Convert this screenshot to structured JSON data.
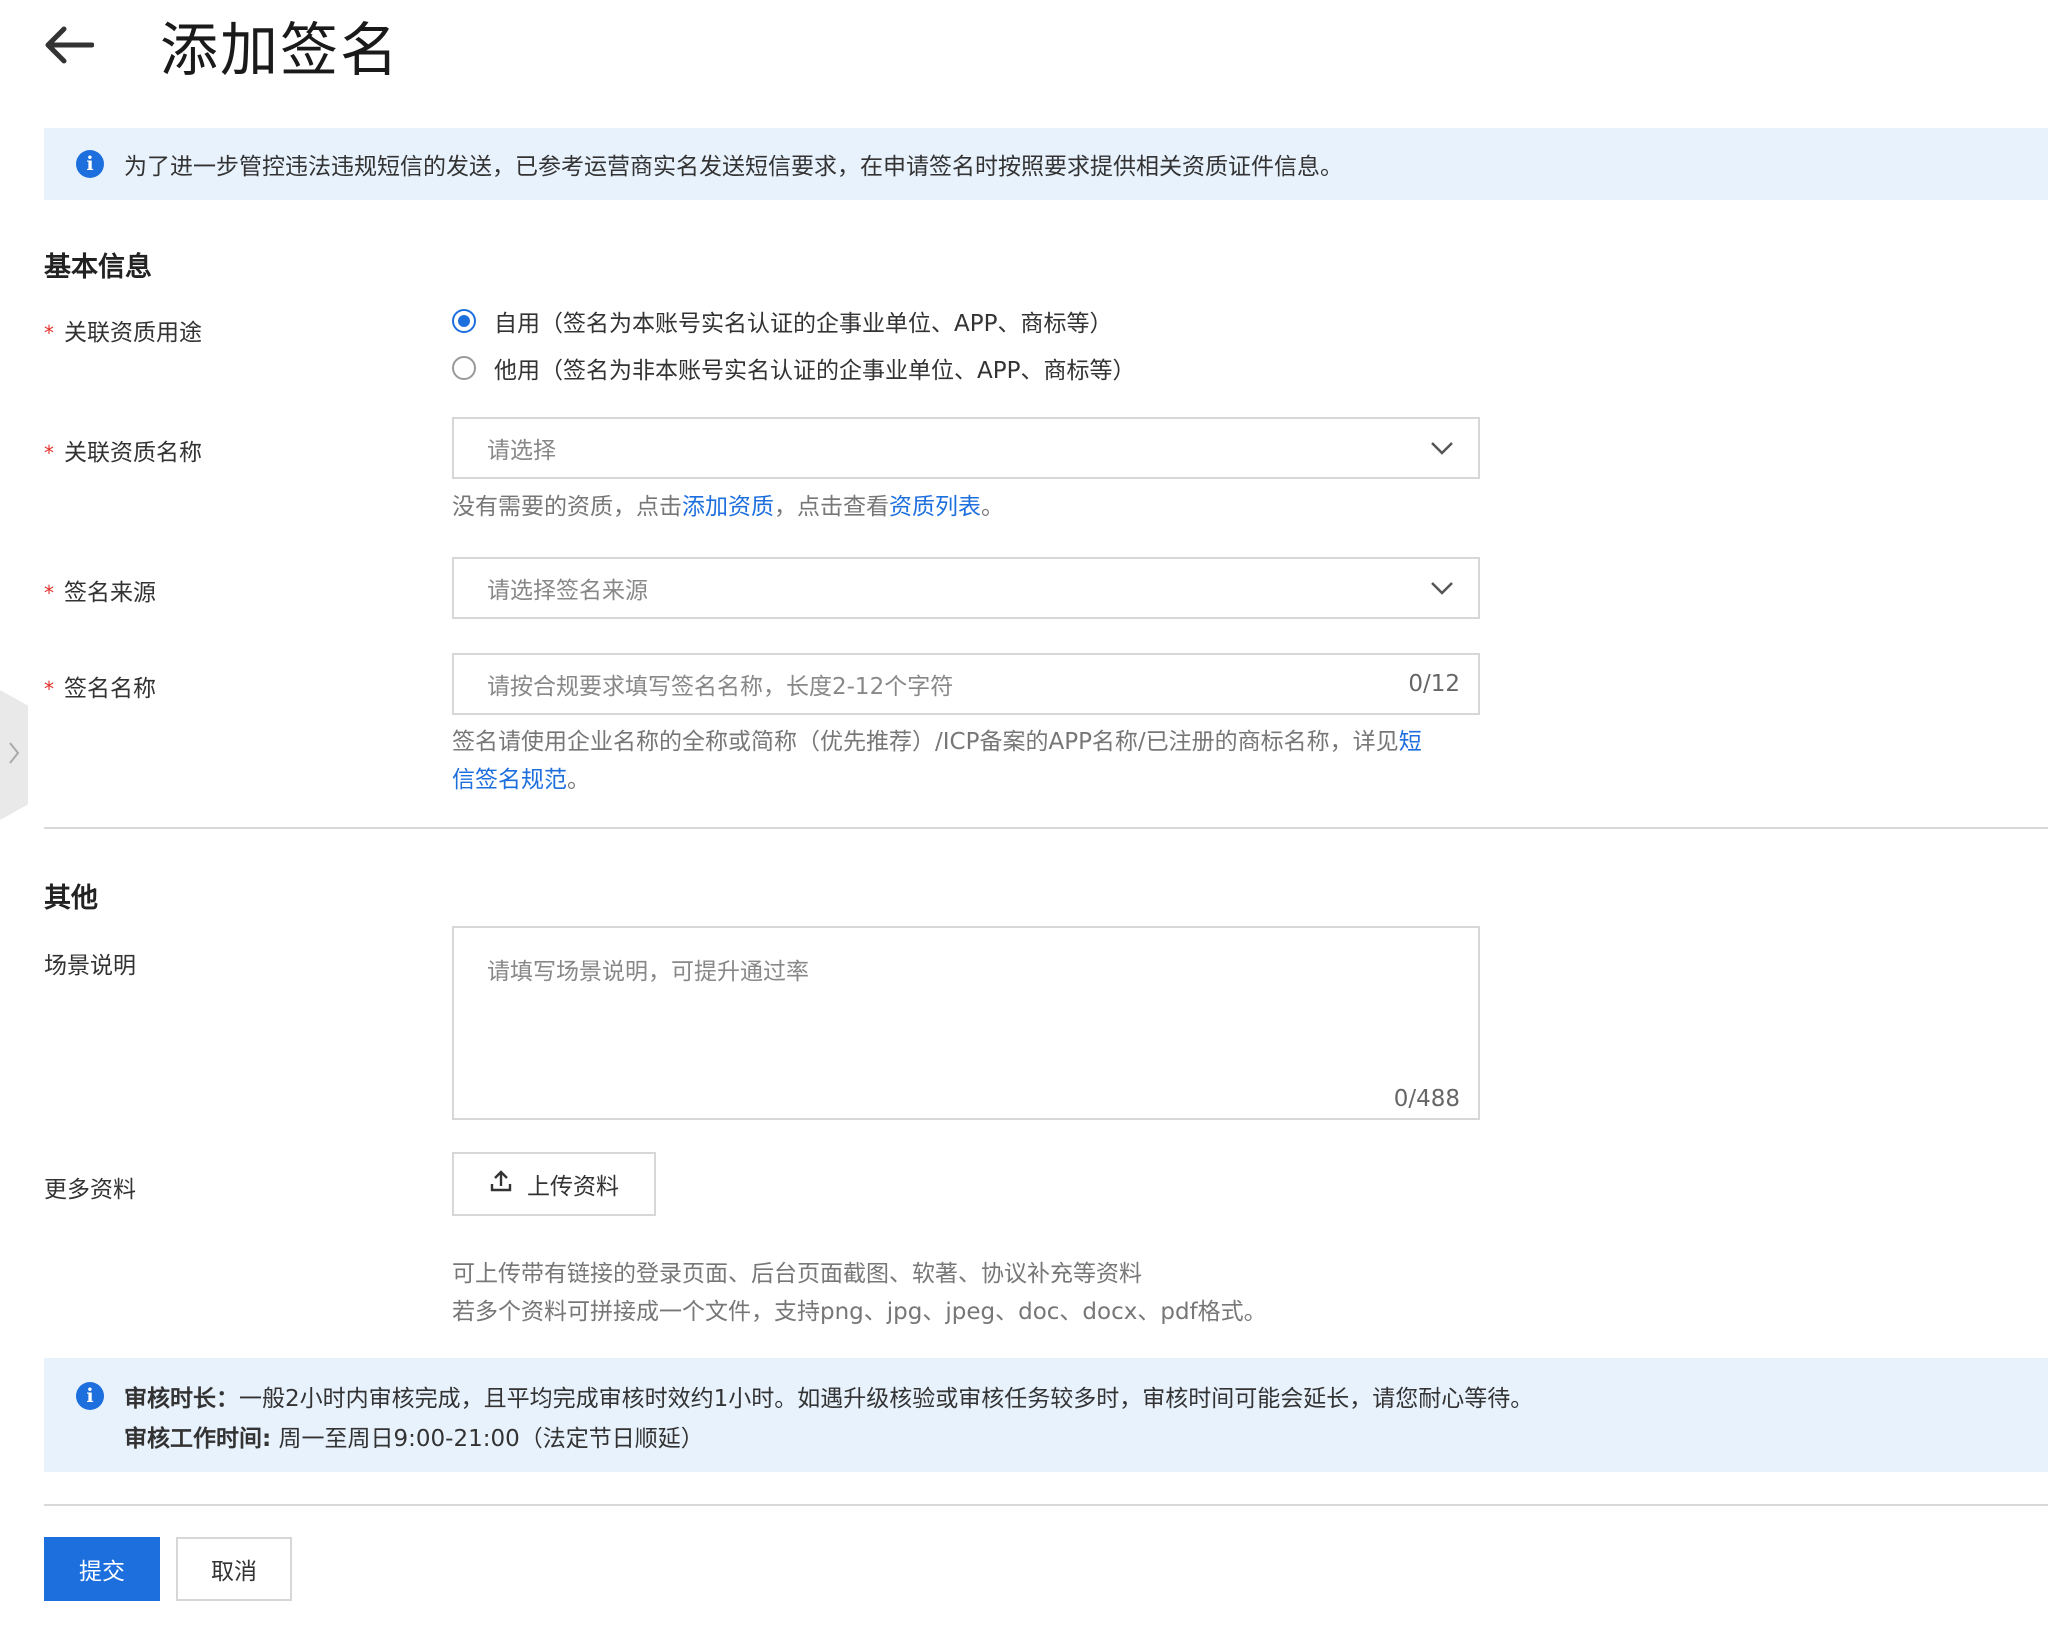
{
  "header": {
    "title": "添加签名"
  },
  "notice_top": {
    "text": "为了进一步管控违法违规短信的发送，已参考运营商实名发送短信要求，在申请签名时按照要求提供相关资质证件信息。"
  },
  "basic_section": {
    "title": "基本信息",
    "usage": {
      "label": "关联资质用途",
      "options": [
        {
          "label": "自用（签名为本账号实名认证的企事业单位、APP、商标等）",
          "checked": true
        },
        {
          "label": "他用（签名为非本账号实名认证的企事业单位、APP、商标等）",
          "checked": false
        }
      ]
    },
    "qualification": {
      "label": "关联资质名称",
      "placeholder": "请选择",
      "help_prefix": "没有需要的资质，点击",
      "help_link1": "添加资质",
      "help_middle": "，点击查看",
      "help_link2": "资质列表",
      "help_suffix": "。"
    },
    "source": {
      "label": "签名来源",
      "placeholder": "请选择签名来源"
    },
    "name": {
      "label": "签名名称",
      "placeholder": "请按合规要求填写签名名称，长度2-12个字符",
      "counter": "0/12",
      "help_prefix": "签名请使用企业名称的全称或简称（优先推荐）/ICP备案的APP名称/已注册的商标名称，详见",
      "help_link_a": "短",
      "help_link_b": "信签名规范",
      "help_suffix": "。"
    }
  },
  "other_section": {
    "title": "其他",
    "scene": {
      "label": "场景说明",
      "placeholder": "请填写场景说明，可提升通过率",
      "counter": "0/488"
    },
    "more": {
      "label": "更多资料",
      "upload_label": "上传资料",
      "help_line1": "可上传带有链接的登录页面、后台页面截图、软著、协议补充等资料",
      "help_line2": "若多个资料可拼接成一个文件，支持png、jpg、jpeg、doc、docx、pdf格式。"
    }
  },
  "notice_bottom": {
    "line1_label": "审核时长：",
    "line1_text": "一般2小时内审核完成，且平均完成审核时效约1小时。如遇升级核验或审核任务较多时，审核时间可能会延长，请您耐心等待。",
    "line2_label": "审核工作时间:",
    "line2_text": " 周一至周日9:00-21:00（法定节日顺延）"
  },
  "actions": {
    "submit": "提交",
    "cancel": "取消"
  },
  "colors": {
    "accent": "#1d6fde",
    "notice_bg": "#e8f2fd",
    "required": "#e0332b"
  },
  "required_mark": "*",
  "info_glyph": "i"
}
